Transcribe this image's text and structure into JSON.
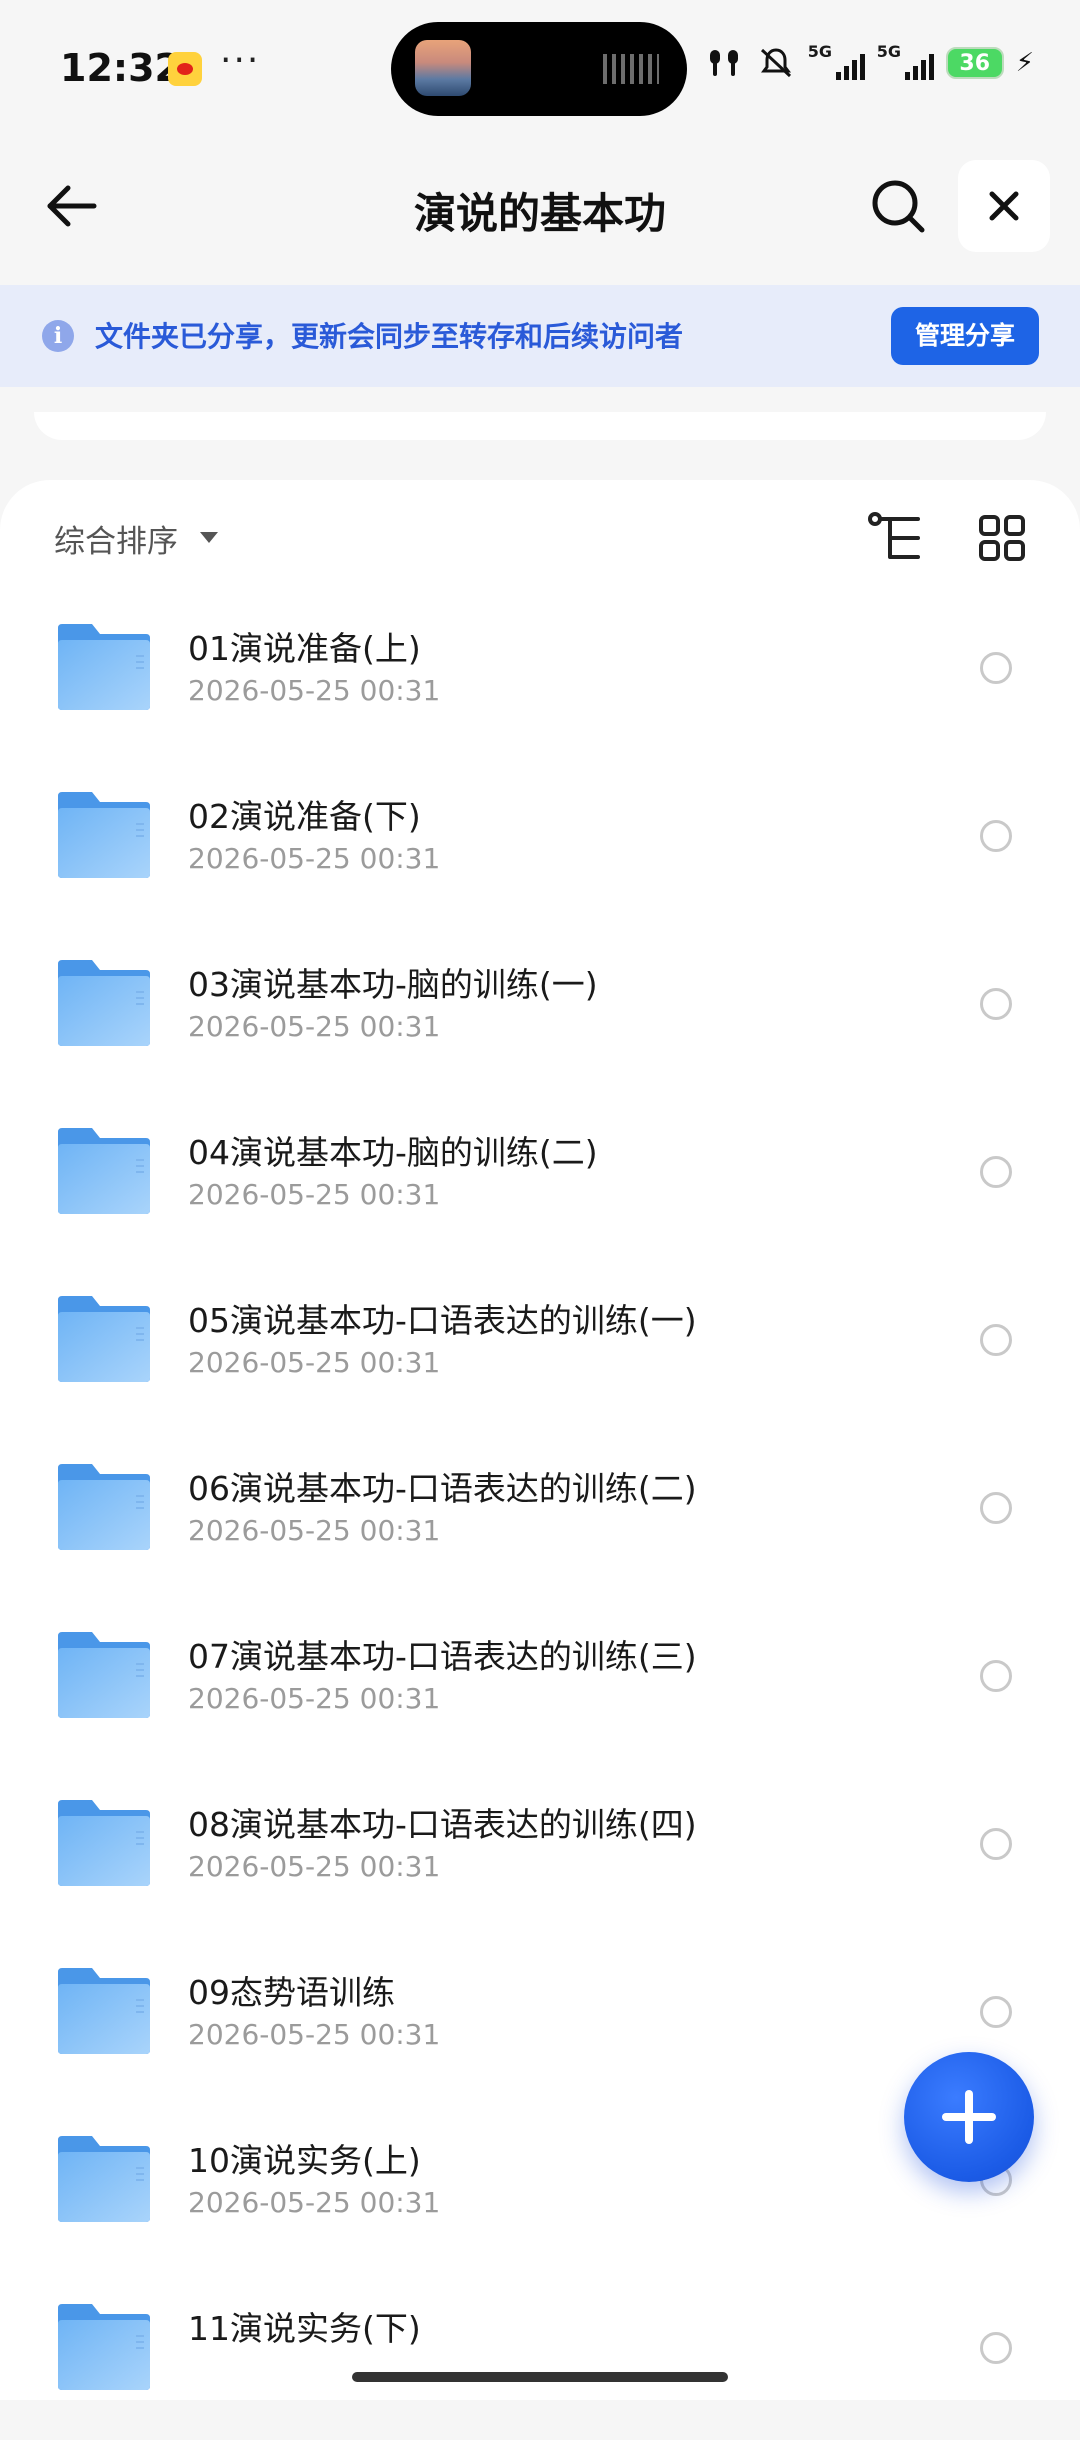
{
  "status_bar": {
    "time": "12:32",
    "more": "···",
    "signal_tag_1": "5G",
    "signal_tag_2": "5G",
    "battery": "36"
  },
  "header": {
    "title": "演说的基本功"
  },
  "banner": {
    "text": "文件夹已分享，更新会同步至转存和后续访问者",
    "button": "管理分享"
  },
  "sortbar": {
    "sort_label": "综合排序"
  },
  "files": [
    {
      "name": "01演说准备(上)",
      "date": "2026-05-25 00:31"
    },
    {
      "name": "02演说准备(下)",
      "date": "2026-05-25 00:31"
    },
    {
      "name": "03演说基本功-脑的训练(一)",
      "date": "2026-05-25 00:31"
    },
    {
      "name": "04演说基本功-脑的训练(二)",
      "date": "2026-05-25 00:31"
    },
    {
      "name": "05演说基本功-口语表达的训练(一)",
      "date": "2026-05-25 00:31"
    },
    {
      "name": "06演说基本功-口语表达的训练(二)",
      "date": "2026-05-25 00:31"
    },
    {
      "name": "07演说基本功-口语表达的训练(三)",
      "date": "2026-05-25 00:31"
    },
    {
      "name": "08演说基本功-口语表达的训练(四)",
      "date": "2026-05-25 00:31"
    },
    {
      "name": "09态势语训练",
      "date": "2026-05-25 00:31"
    },
    {
      "name": "10演说实务(上)",
      "date": "2026-05-25 00:31"
    },
    {
      "name": "11演说实务(下)",
      "date": ""
    }
  ],
  "icons": {
    "back": "back-arrow-icon",
    "search": "search-icon",
    "close": "close-icon",
    "info": "info-icon",
    "tree": "tree-view-icon",
    "grid": "grid-view-icon",
    "folder": "folder-icon",
    "add": "plus-icon"
  },
  "colors": {
    "accent": "#1e64e6",
    "banner_bg": "#e7ecfa",
    "banner_text": "#2a5ad8",
    "folder": "#5fa8f0"
  }
}
